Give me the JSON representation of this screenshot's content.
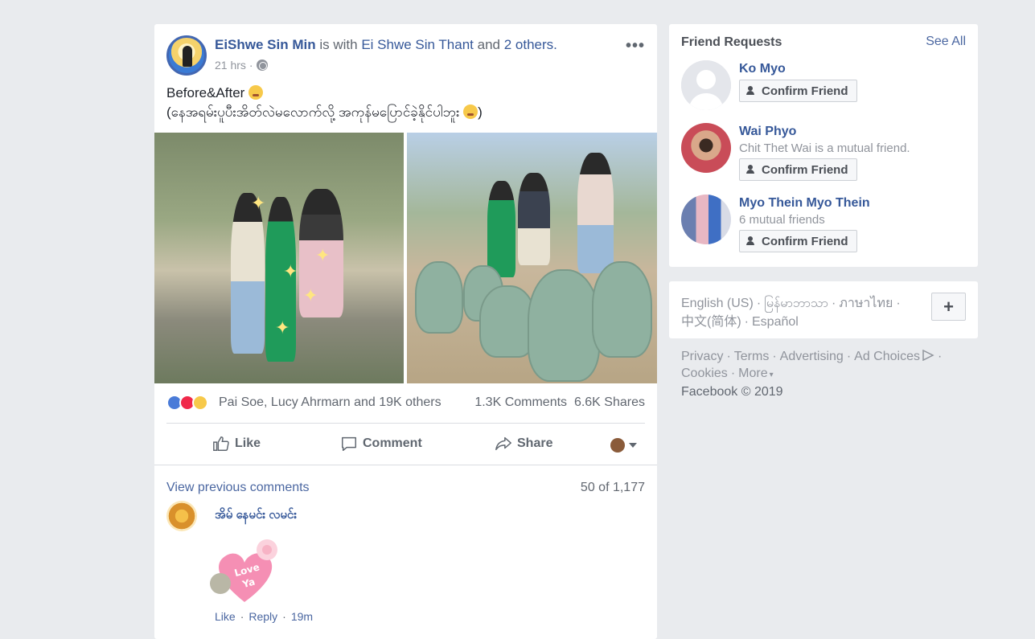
{
  "post": {
    "author": "EiShwe Sin Min",
    "with_text": "is with",
    "tagged": "Ei Shwe Sin Thant",
    "and_text": "and",
    "others": "2 others.",
    "time": "21 hrs",
    "time_sep": "·",
    "options": "•••",
    "text_line1": "Before&After",
    "text_line2": "(နေအရမ်းပူပီးအိတ်လဲမလောက်လို့ အကုန်မပြောင်ခဲ့နိုင်ပါဘူး",
    "text_line2_end": ")",
    "reactions_names": "Pai Soe, Lucy Ahrmarn and 19K others",
    "comments_count": "1.3K Comments",
    "shares_count": "6.6K Shares",
    "actions": {
      "like": "Like",
      "comment": "Comment",
      "share": "Share"
    },
    "view_previous": "View previous comments",
    "comments_position": "50 of 1,177",
    "comment": {
      "author": "အိမ် နေမင်း လမင်း",
      "like": "Like",
      "reply": "Reply",
      "sep": "·",
      "time": "19m"
    }
  },
  "friend_requests": {
    "title": "Friend Requests",
    "see_all": "See All",
    "confirm_label": "Confirm Friend",
    "items": [
      {
        "name": "Ko Myo",
        "sub": ""
      },
      {
        "name": "Wai Phyo",
        "sub": "Chit Thet Wai is a mutual friend."
      },
      {
        "name": "Myo Thein Myo Thein",
        "sub": "6 mutual friends"
      }
    ]
  },
  "languages": {
    "line1": [
      "English (US)",
      "မြန်မာဘာသာ",
      "ภาษาไทย"
    ],
    "line2": [
      "中文(简体)",
      "Español"
    ],
    "sep": "·",
    "add": "+"
  },
  "footer": {
    "links1": [
      "Privacy",
      "Terms",
      "Advertising",
      "Ad Choices"
    ],
    "links2": [
      "Cookies",
      "More"
    ],
    "copyright": "Facebook © 2019"
  },
  "colors": {
    "link": "#365899",
    "background": "#e9ebee",
    "like_blue": "#4a7bd8",
    "love_red": "#f0284a"
  }
}
